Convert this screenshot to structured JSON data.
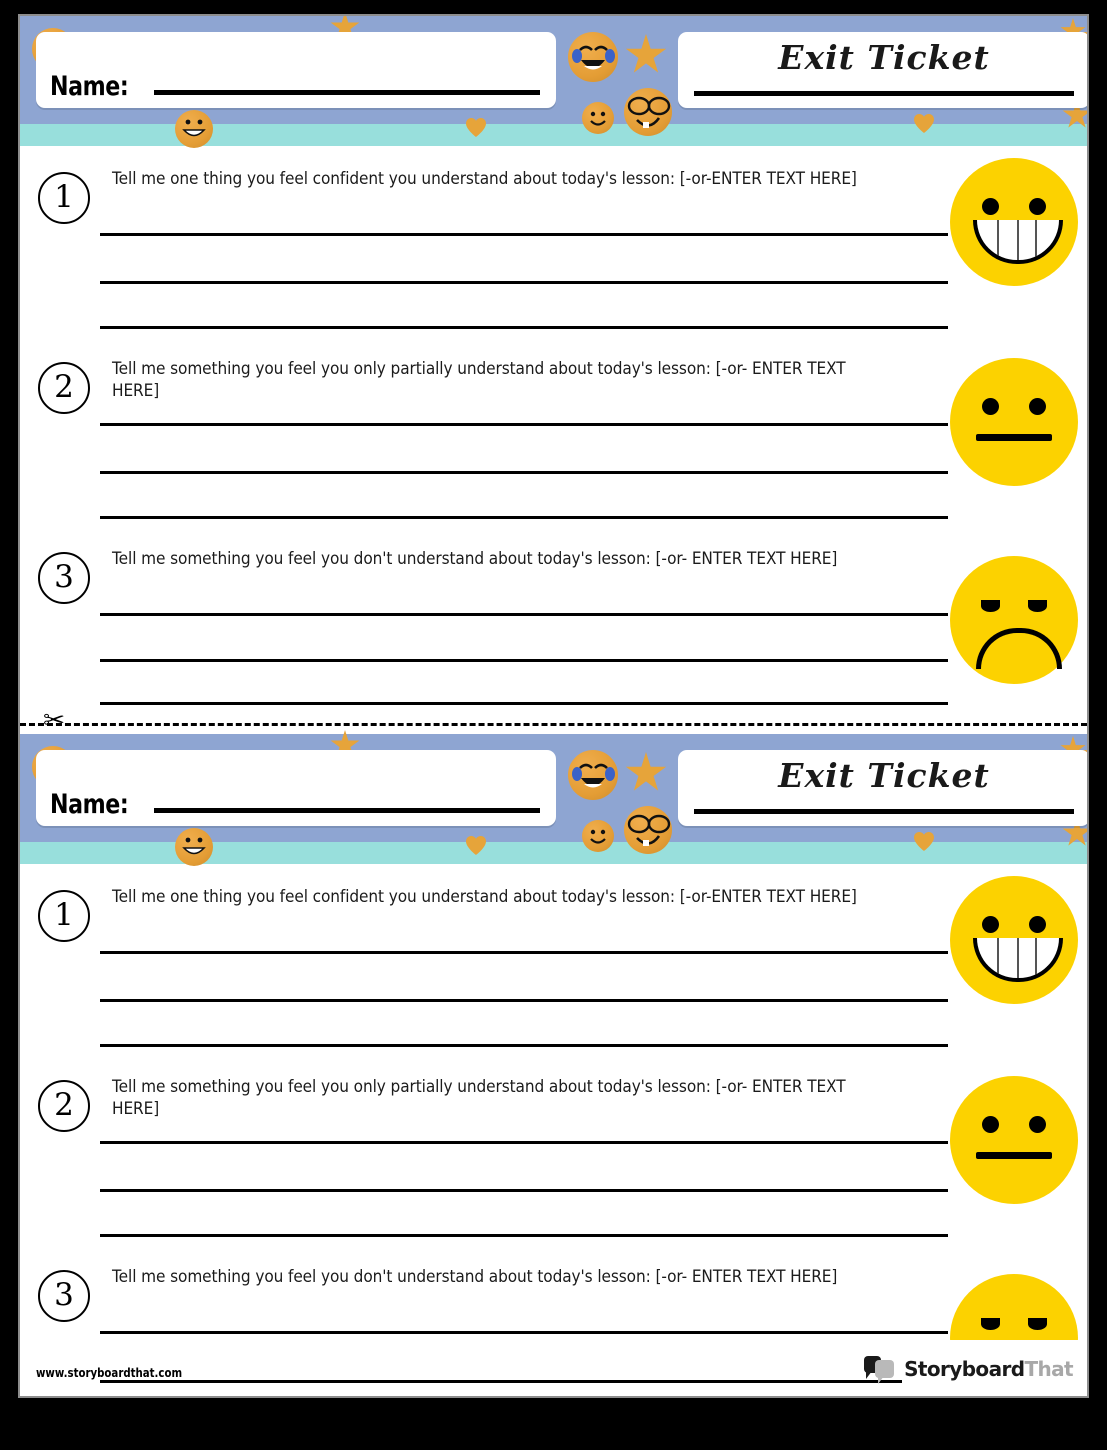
{
  "document": {
    "type": "exit-ticket-worksheet",
    "colors": {
      "band_blue": "#8ea5d2",
      "band_teal": "#98dfdc",
      "emoji_orange": "#e6a43a",
      "face_yellow": "#fcd200",
      "face_shadow": "#e9c000",
      "logo_dark": "#1a1a1a",
      "logo_gray": "#a8a8a8"
    }
  },
  "tickets": [
    {
      "header": {
        "name_label": "Name:",
        "name_value": "",
        "title": "Exit Ticket"
      },
      "questions": [
        {
          "number": "1",
          "text": "Tell me one thing you feel confident you understand about today's lesson: [-or-ENTER TEXT HERE]",
          "answer_lines": 3,
          "face": "happy-face"
        },
        {
          "number": "2",
          "text": "Tell me something you feel you only partially understand about today's lesson: [-or- ENTER TEXT HERE]",
          "answer_lines": 3,
          "face": "neutral-face"
        },
        {
          "number": "3",
          "text": "Tell me something you feel you don't understand about today's lesson: [-or- ENTER TEXT HERE]",
          "answer_lines": 3,
          "face": "sad-face"
        }
      ]
    },
    {
      "header": {
        "name_label": "Name:",
        "name_value": "",
        "title": "Exit Ticket"
      },
      "questions": [
        {
          "number": "1",
          "text": "Tell me one thing you feel confident you understand about today's lesson: [-or-ENTER TEXT HERE]",
          "answer_lines": 3,
          "face": "happy-face"
        },
        {
          "number": "2",
          "text": "Tell me something you feel you only partially understand about today's lesson: [-or- ENTER TEXT HERE]",
          "answer_lines": 3,
          "face": "neutral-face"
        },
        {
          "number": "3",
          "text": "Tell me something you feel you don't understand about today's lesson: [-or- ENTER TEXT HERE]",
          "answer_lines": 2,
          "face": "sad-face"
        }
      ]
    }
  ],
  "cut_line": {
    "icon": "scissors-icon",
    "glyph": "✂"
  },
  "footer": {
    "url": "www.storyboardthat.com",
    "logo_primary": "Storyboard",
    "logo_secondary": "That"
  },
  "decorations": [
    "sunglasses-emoji",
    "laughing-tears-emoji",
    "nerd-glasses-emoji",
    "heart-eyes-emoji",
    "small-smiley-emoji",
    "grinning-emoji",
    "star-shape",
    "heart-shape"
  ]
}
